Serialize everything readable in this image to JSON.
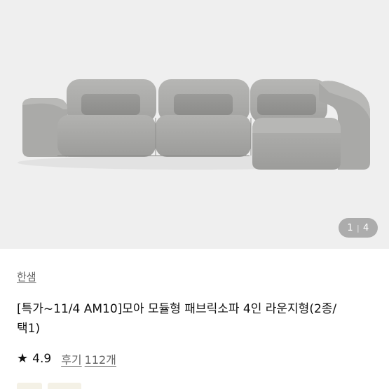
{
  "image": {
    "subject": "sofa-product-photo",
    "background": "#efefef",
    "fabric_color": "#a7a7a5"
  },
  "gallery": {
    "current": "1",
    "total": "4",
    "separator": "|"
  },
  "product": {
    "brand": "한샘",
    "title": "[특가~11/4 AM10]모아 모듈형 패브릭소파 4인 라운지형(2종/택1)",
    "rating": "4.9",
    "reviews_label": "후기",
    "reviews_count": "112개"
  },
  "icons": {
    "rating": "star-icon"
  }
}
